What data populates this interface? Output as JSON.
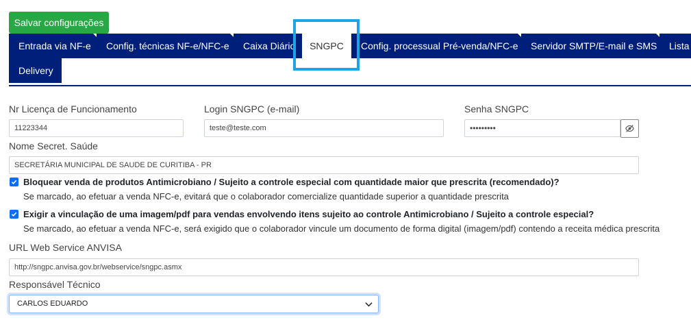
{
  "toolbar": {
    "save_label": "Salvar configurações"
  },
  "tabs": [
    {
      "label": "Entrada via NF-e"
    },
    {
      "label": "Config. técnicas NF-e/NFC-e"
    },
    {
      "label": "Caixa Diário"
    },
    {
      "label": "SNGPC",
      "active": true
    },
    {
      "label": "Config. processual Pré-venda/NFC-e"
    },
    {
      "label": "Servidor SMTP/E-mail e SMS"
    },
    {
      "label": "Lista A"
    },
    {
      "label": "Delivery"
    }
  ],
  "form": {
    "licenca": {
      "label": "Nr Licença de Funcionamento",
      "value": "11223344"
    },
    "login": {
      "label": "Login SNGPC (e-mail)",
      "value": "teste@teste.com"
    },
    "senha": {
      "label": "Senha SNGPC",
      "value": "•••••••••"
    },
    "secretaria": {
      "label": "Nome Secret. Saúde",
      "value": "SECRETÁRIA MUNICIPAL DE SAUDE DE CURITIBA - PR"
    },
    "check1": {
      "checked": true,
      "title": "Bloquear venda de produtos Antimicrobiano / Sujeito a controle especial com quantidade maior que prescrita (recomendado)?",
      "description": "Se marcado, ao efetuar a venda NFC-e, evitará que o colaborador comercialize quantidade superior a quantidade prescrita"
    },
    "check2": {
      "checked": true,
      "title": "Exigir a vinculação de uma imagem/pdf para vendas envolvendo itens sujeito ao controle Antimicrobiano / Sujeito a controle especial?",
      "description": "Se marcado, ao efetuar a venda NFC-e, será exigido que o colaborador vincule um documento de forma digital (imagem/pdf) contendo a receita médica prescrita"
    },
    "url": {
      "label": "URL Web Service ANVISA",
      "value": "http://sngpc.anvisa.gov.br/webservice/sngpc.asmx"
    },
    "responsavel": {
      "label": "Responsável Técnico",
      "selected": "CARLOS EDUARDO"
    }
  },
  "colors": {
    "tab_bg": "#001f7a",
    "save_button": "#28a745",
    "highlight": "#1aa5e6",
    "checkbox": "#0d6efd"
  },
  "icons": [
    "eye-slash-icon",
    "check-icon",
    "chevron-down-icon"
  ]
}
